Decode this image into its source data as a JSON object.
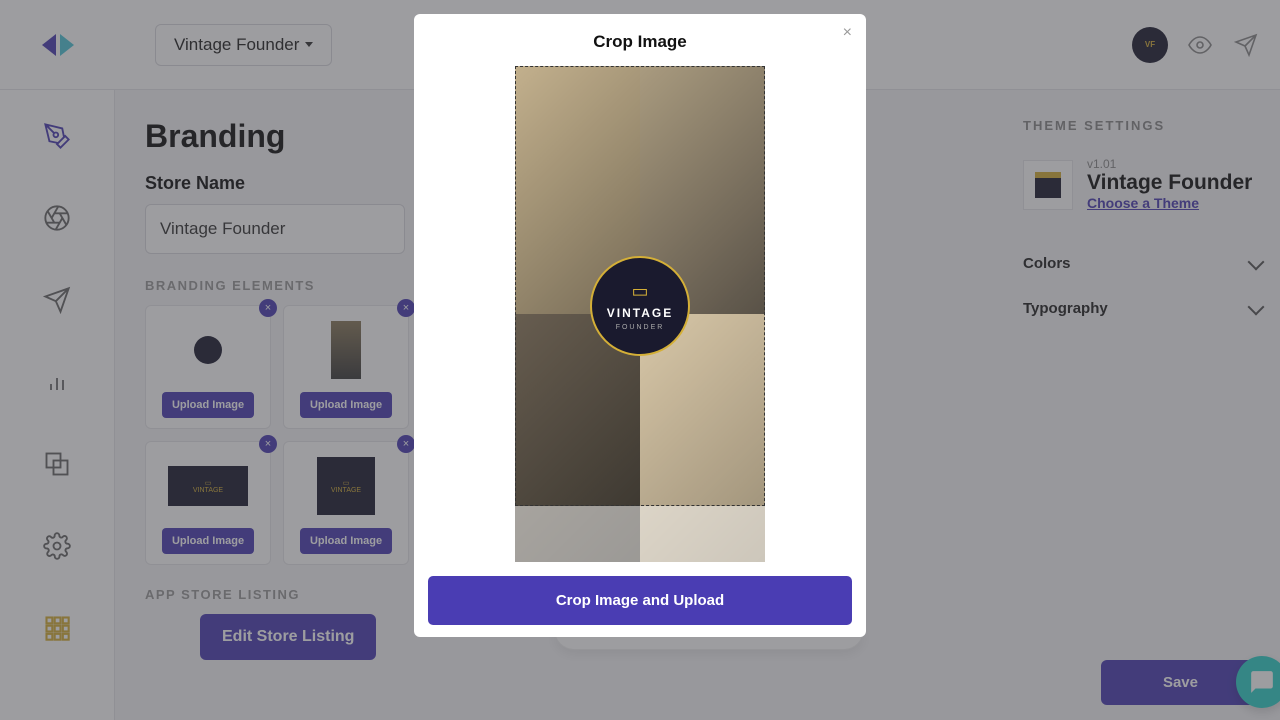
{
  "topbar": {
    "store_dropdown": "Vintage Founder"
  },
  "page": {
    "title": "Branding",
    "store_name_label": "Store Name",
    "store_name_value": "Vintage Founder",
    "branding_section": "BRANDING ELEMENTS",
    "listing_section": "APP STORE LISTING",
    "upload_label": "Upload Image",
    "edit_listing_label": "Edit Store Listing"
  },
  "rightpanel": {
    "title": "THEME SETTINGS",
    "version": "v1.01",
    "theme_name": "Vintage Founder",
    "choose_theme": "Choose a Theme",
    "accordion": {
      "colors": "Colors",
      "typography": "Typography"
    }
  },
  "save_label": "Save",
  "modal": {
    "title": "Crop Image",
    "badge_top": "VINTAGE",
    "badge_sub": "FOUNDER",
    "action": "Crop Image and Upload"
  }
}
